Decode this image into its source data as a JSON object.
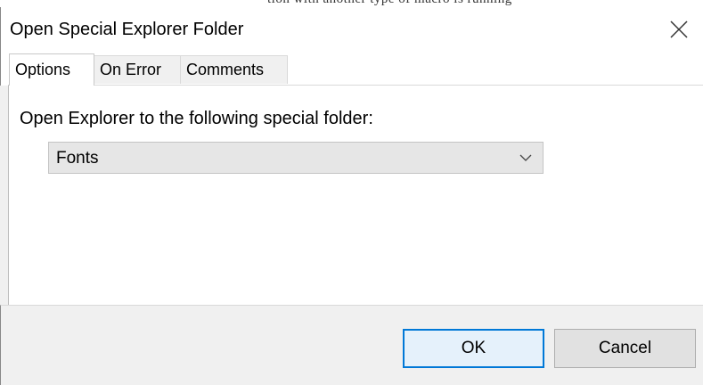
{
  "window": {
    "title": "Open Special Explorer Folder"
  },
  "background": {
    "text": "tion with another type of macro is running"
  },
  "tabs": [
    {
      "label": "Options",
      "active": true
    },
    {
      "label": "On Error",
      "active": false
    },
    {
      "label": "Comments",
      "active": false
    }
  ],
  "options": {
    "label": "Open Explorer to the following special folder:",
    "folder_select": {
      "selected": "Fonts"
    }
  },
  "footer": {
    "ok_label": "OK",
    "cancel_label": "Cancel"
  },
  "colors": {
    "accent": "#0078d7",
    "dialog_bg": "#f0f0f0",
    "panel_bg": "#ffffff"
  }
}
